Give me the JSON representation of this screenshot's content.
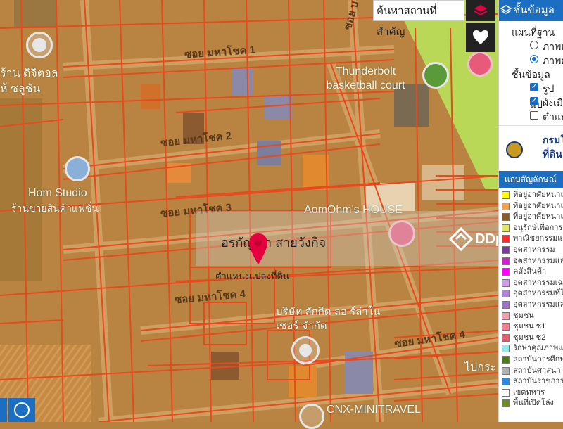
{
  "map": {
    "road_labels": [
      "ซอย มหาโชค 1",
      "ซอย มหาโชค 2",
      "ซอย มหาโชค 3",
      "ซอย มหาโชค 4",
      "ซอย มหาโชค 4",
      "ซอย บ"
    ],
    "poi_labels": {
      "thunderbolt": "Thunderbolt basketball court",
      "hom_studio": "Hom Studio",
      "hom_studio_sub": "ร้านขายสินค้าแฟชั่น",
      "aomohm": "AomOhm's HOUSE",
      "company": "บริษัท ลักกิด ลอ ร์ล่าในเชอร์ จำกัด",
      "cnx": "CNX-MINITRAVEL",
      "left_top": "ร้าน ดิจิตอล",
      "left_top2": "ห้ ซลูชัน",
      "right_bottom": "ไปกระ"
    },
    "owner_name": "อรกัญญา สายวังกิจ",
    "change_label": "ตำแหน่งแปลงที่ดิน",
    "watermark": "DDproperty",
    "colors": {
      "parcel": "#e8491d",
      "land": "#b7823f",
      "green_zone": "#b9e65a",
      "pin": "#e5003f"
    }
  },
  "search": {
    "placeholder": "ค้นหาสถานที่สำคัญ"
  },
  "panel": {
    "title": "ชั้นข้อมูล",
    "basemap_heading": "แผนที่ฐาน",
    "basemap_options": [
      "ภาพแ",
      "ภาพด"
    ],
    "layers_heading": "ชั้นข้อมูล",
    "layers": [
      {
        "label": "รูปแป",
        "checked": true
      },
      {
        "label": "ผังเมื",
        "checked": true
      },
      {
        "label": "ตำแห",
        "checked": false
      }
    ],
    "dept_title": "กรมโ",
    "dept_sub": "ที่ดิน",
    "legend_title": "แถบสัญลักษณ์",
    "legend": [
      {
        "label": "ที่อยู่อาศัยหนาแน่น",
        "color": "#ffff00"
      },
      {
        "label": "ที่อยู่อาศัยหนาแน่น",
        "color": "#f5a04a"
      },
      {
        "label": "ที่อยู่อาศัยหนาแน่น",
        "color": "#8b5a2b"
      },
      {
        "label": "อนุรักษ์เพื่อการอ",
        "color": "#e3e86a"
      },
      {
        "label": "พาณิชยกรรมและ",
        "color": "#ff2a2a"
      },
      {
        "label": "อุตสาหกรรม",
        "color": "#7a3a9a"
      },
      {
        "label": "อุตสาหกรรมและ",
        "color": "#d51cd5"
      },
      {
        "label": "คลังสินค้า",
        "color": "#ff00ff"
      },
      {
        "label": "อุตสาหกรรมเฉพ",
        "color": "#cda0e6"
      },
      {
        "label": "อุตสาหกรรมที่ไม่",
        "color": "#b280e0"
      },
      {
        "label": "อุตสาหกรรมและ",
        "color": "#a070d0"
      },
      {
        "label": "ชุมชน",
        "color": "#f5a0b0"
      },
      {
        "label": "ชุมชน ช1",
        "color": "#f08090"
      },
      {
        "label": "ชุมชน ช2",
        "color": "#e06070"
      },
      {
        "label": "รักษาคุณภาพแล",
        "color": "#8feaea"
      },
      {
        "label": "สถาบันการศึกษ",
        "color": "#4f7a1a"
      },
      {
        "label": "สถาบันศาสนา",
        "color": "#b0b0b0"
      },
      {
        "label": "สถาบันราชการ",
        "color": "#2a8ae0"
      },
      {
        "label": "เขตทหาร",
        "color": "#ffffff"
      },
      {
        "label": "พื้นที่เปิดโล่ง",
        "color": "#6b8e23"
      }
    ]
  }
}
